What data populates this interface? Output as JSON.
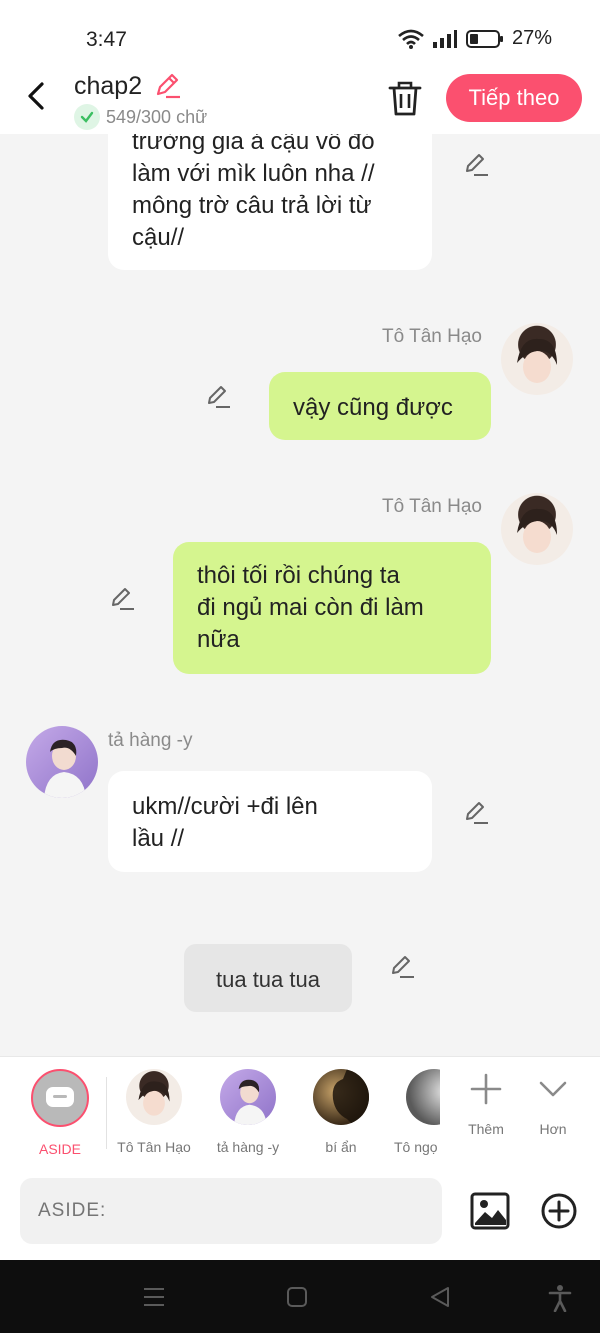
{
  "status_bar": {
    "time": "3:47",
    "battery": "27%"
  },
  "header": {
    "title": "chap2",
    "word_count": "549/300 chữ",
    "next_label": "Tiếp theo"
  },
  "messages": [
    {
      "sender": "",
      "text_lines": [
        "trường gia ả cậu vô đó",
        "làm với mìk luôn nha //",
        "mông trờ câu trả lời từ",
        "cậu//"
      ]
    },
    {
      "sender": "Tô Tân Hạo",
      "text_lines": [
        "vậy cũng được"
      ]
    },
    {
      "sender": "Tô Tân Hạo",
      "text_lines": [
        "thôi tối rồi chúng ta",
        "đi ngủ mai còn đi làm",
        "nữa"
      ]
    },
    {
      "sender": "tả hàng -y",
      "text_lines": [
        "ukm//cười +đi lên",
        "lầu //"
      ]
    },
    {
      "sender": "",
      "text_lines": [
        "tua tua tua"
      ]
    }
  ],
  "characters": [
    {
      "label": "ASIDE"
    },
    {
      "label": "Tô Tân Hạo"
    },
    {
      "label": "tả hàng -y"
    },
    {
      "label": "bí ẩn"
    },
    {
      "label": "Tô ngọ"
    }
  ],
  "char_actions": {
    "add_label": "Thêm",
    "more_label": "Hơn"
  },
  "input": {
    "placeholder": "ASIDE:"
  },
  "colors": {
    "accent": "#fb506f",
    "green_bubble": "#d5f58f"
  }
}
